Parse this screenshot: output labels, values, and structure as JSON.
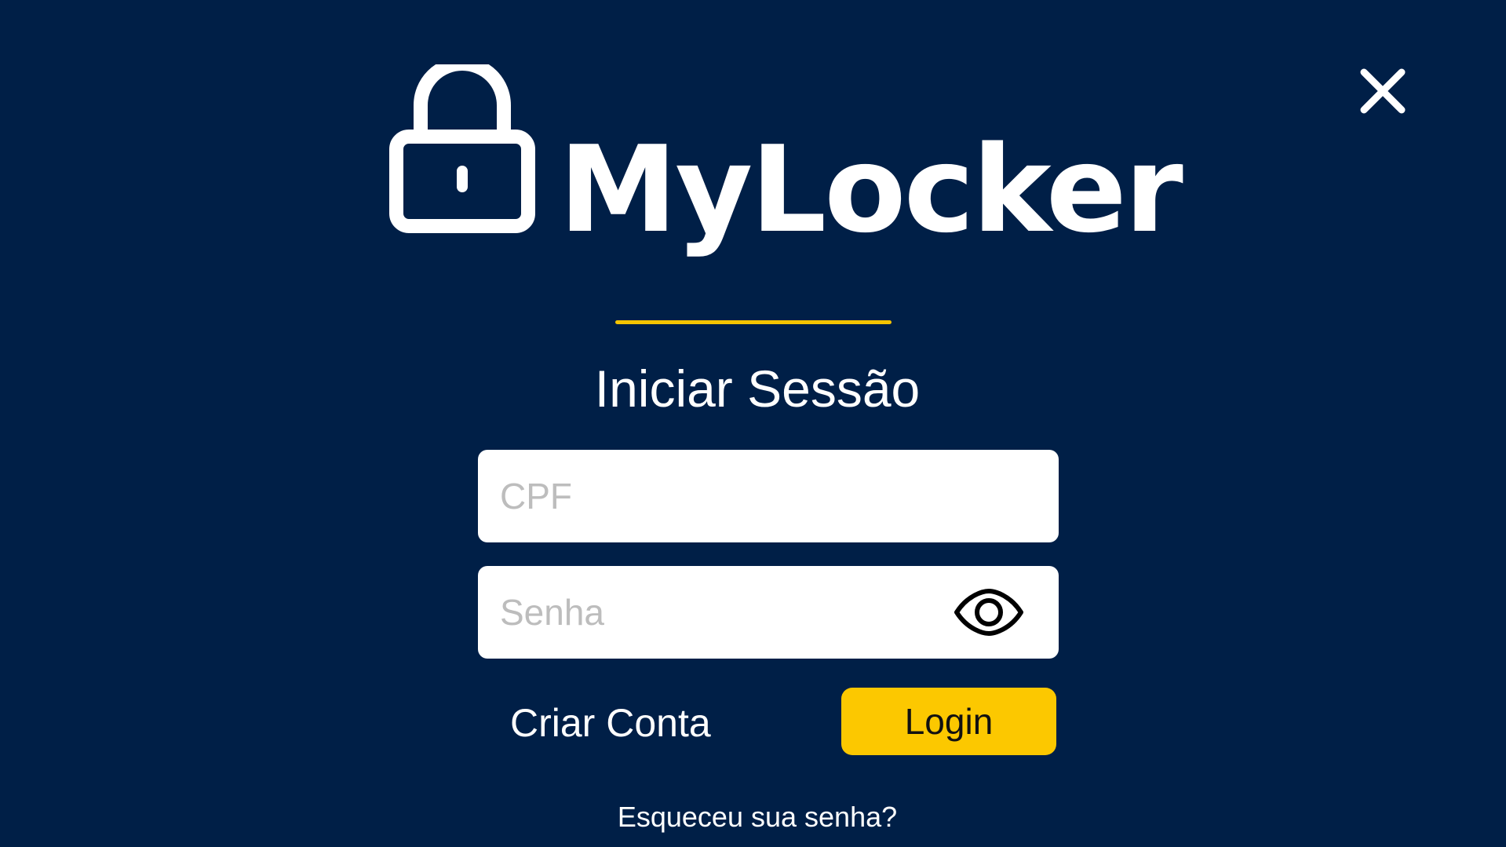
{
  "app": {
    "brand_name": "MyLocker",
    "colors": {
      "background": "#001f47",
      "accent": "#fcc800",
      "text": "#ffffff"
    }
  },
  "header": {
    "close_icon": "close-icon"
  },
  "logo": {
    "icon": "lock-icon",
    "text": "MyLocker"
  },
  "login_form": {
    "title": "Iniciar Sessão",
    "cpf_placeholder": "CPF",
    "cpf_value": "",
    "password_placeholder": "Senha",
    "password_value": "",
    "show_password_icon": "eye-icon",
    "create_account_label": "Criar Conta",
    "login_label": "Login",
    "forgot_password_label": "Esqueceu sua senha?"
  }
}
